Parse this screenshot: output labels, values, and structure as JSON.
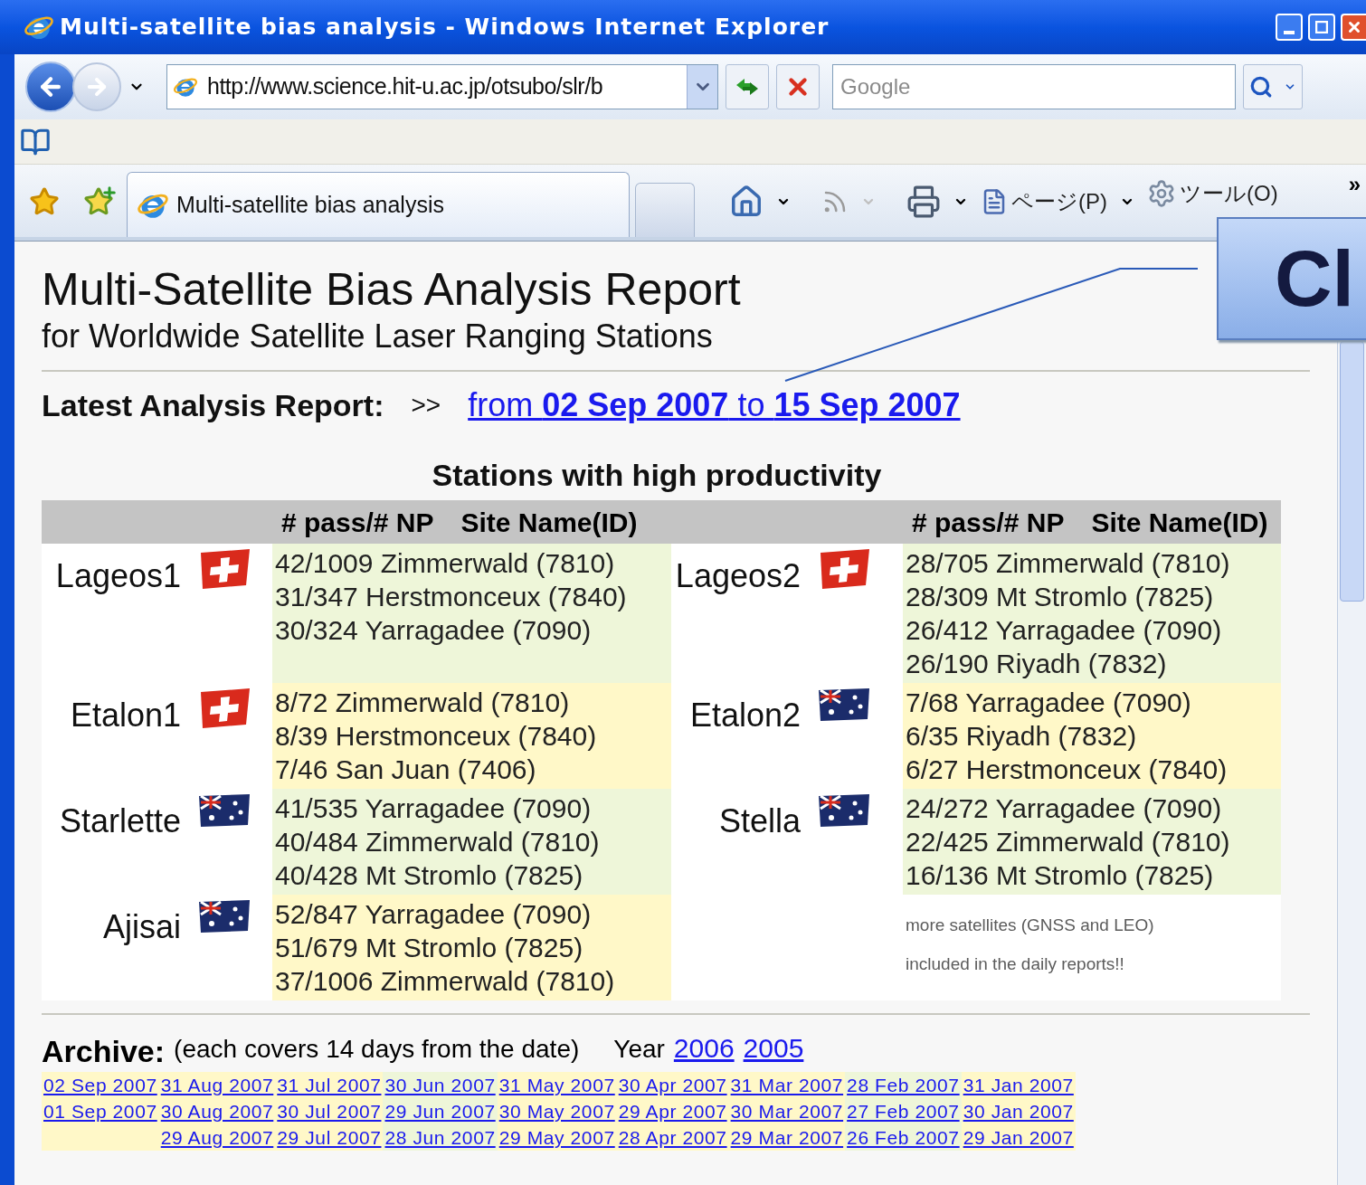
{
  "window": {
    "title": "Multi-satellite bias analysis - Windows Internet Explorer"
  },
  "address_bar": {
    "url": "http://www.science.hit-u.ac.jp/otsubo/slr/b"
  },
  "search": {
    "placeholder": "Google"
  },
  "tabs": [
    {
      "label": "Multi-satellite bias analysis",
      "selected": true
    }
  ],
  "command_bar": {
    "page_menu": "ページ(P)",
    "tools_menu": "ツール(O)",
    "overflow": "»"
  },
  "callout": {
    "text": "Cl"
  },
  "page": {
    "title": "Multi-Satellite Bias Analysis Report",
    "subtitle": "for Worldwide Satellite Laser Ranging Stations",
    "latest": {
      "label": "Latest Analysis Report:",
      "arrows": ">>",
      "link": "from **02 Sep 2007** to **15 Sep 2007**"
    }
  },
  "stations": {
    "title": "Stations with high productivity",
    "header": [
      "# pass/# NP",
      "Site Name(ID)",
      "# pass/# NP",
      "Site Name(ID)"
    ],
    "rows": [
      {
        "left": {
          "name": "Lageos1",
          "kind": "swiss",
          "color": "#eef6d9",
          "lines": [
            "42/1009 Zimmerwald (7810)",
            "31/347 Herstmonceux (7840)",
            "30/324 Yarragadee (7090)"
          ]
        },
        "right": {
          "name": "Lageos2",
          "kind": "swiss",
          "color": "#eef6d9",
          "lines": [
            "28/705 Zimmerwald (7810)",
            "28/309 Mt Stromlo (7825)",
            "26/412 Yarragadee (7090)",
            "26/190 Riyadh (7832)"
          ]
        }
      },
      {
        "left": {
          "name": "Etalon1",
          "kind": "swiss",
          "color": "#fff8c8",
          "lines": [
            "8/72 Zimmerwald (7810)",
            "8/39 Herstmonceux (7840)",
            "7/46 San Juan (7406)"
          ]
        },
        "right": {
          "name": "Etalon2",
          "kind": "australian",
          "color": "#fff8c8",
          "lines": [
            "7/68 Yarragadee (7090)",
            "6/35 Riyadh (7832)",
            "6/27 Herstmonceux (7840)"
          ]
        }
      },
      {
        "left": {
          "name": "Starlette",
          "kind": "australian",
          "color": "#eef6d9",
          "lines": [
            "41/535 Yarragadee (7090)",
            "40/484 Zimmerwald (7810)",
            "40/428 Mt Stromlo (7825)"
          ]
        },
        "right": {
          "name": "Stella",
          "kind": "australian",
          "color": "#eef6d9",
          "lines": [
            "24/272 Yarragadee (7090)",
            "22/425 Zimmerwald (7810)",
            "16/136 Mt Stromlo (7825)"
          ]
        }
      },
      {
        "left": {
          "name": "Ajisai",
          "kind": "australian",
          "color": "#fff8c8",
          "lines": [
            "52/847 Yarragadee (7090)",
            "51/679 Mt Stromlo (7825)",
            "37/1006 Zimmerwald (7810)"
          ]
        },
        "right": {
          "kind": "note",
          "lines": [
            "more satellites (GNSS and LEO)",
            "included in the daily reports!!"
          ]
        }
      }
    ]
  },
  "archive": {
    "label": "Archive:",
    "note": "(each covers 14 days from the date)",
    "year_label": "Year",
    "years": [
      "2006",
      "2005"
    ],
    "columns": [
      {
        "color": "#fff8c8",
        "dates": [
          "02 Sep 2007",
          "01 Sep 2007"
        ]
      },
      {
        "color": "#fff8c8",
        "dates": [
          "31 Aug 2007",
          "30 Aug 2007",
          "29 Aug 2007"
        ]
      },
      {
        "color": "#fff8c8",
        "dates": [
          "31 Jul 2007",
          "30 Jul 2007",
          "29 Jul 2007"
        ]
      },
      {
        "color": "#eef6d9",
        "dates": [
          "30 Jun 2007",
          "29 Jun 2007",
          "28 Jun 2007"
        ]
      },
      {
        "color": "#fff8c8",
        "dates": [
          "31 May 2007",
          "30 May 2007",
          "29 May 2007"
        ]
      },
      {
        "color": "#fff8c8",
        "dates": [
          "30 Apr 2007",
          "29 Apr 2007",
          "28 Apr 2007"
        ]
      },
      {
        "color": "#fff8c8",
        "dates": [
          "31 Mar 2007",
          "30 Mar 2007",
          "29 Mar 2007"
        ]
      },
      {
        "color": "#eef6d9",
        "dates": [
          "28 Feb 2007",
          "27 Feb 2007",
          "26 Feb 2007"
        ]
      },
      {
        "color": "#fff8c8",
        "dates": [
          "31 Jan 2007",
          "30 Jan 2007",
          "29 Jan 2007"
        ]
      }
    ]
  }
}
